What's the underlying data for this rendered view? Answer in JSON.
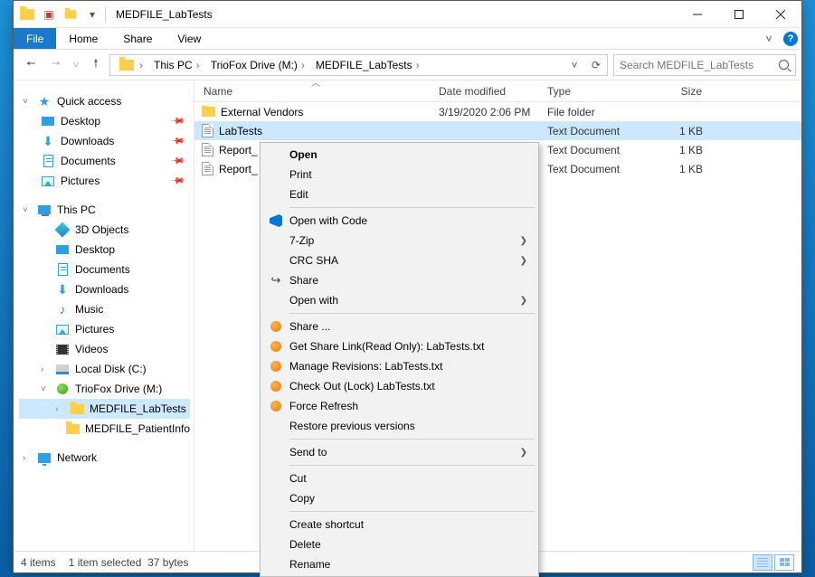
{
  "window": {
    "title": "MEDFILE_LabTests"
  },
  "ribbon": {
    "file": "File",
    "home": "Home",
    "share": "Share",
    "view": "View"
  },
  "breadcrumbs": {
    "thispc": "This PC",
    "drive": "TrioFox Drive (M:)",
    "folder": "MEDFILE_LabTests"
  },
  "search": {
    "placeholder": "Search MEDFILE_LabTests"
  },
  "columns": {
    "name": "Name",
    "date": "Date modified",
    "type": "Type",
    "size": "Size"
  },
  "nav": {
    "quick_access": "Quick access",
    "desktop": "Desktop",
    "downloads": "Downloads",
    "documents": "Documents",
    "pictures": "Pictures",
    "this_pc": "This PC",
    "objects3d": "3D Objects",
    "music": "Music",
    "videos": "Videos",
    "localdisk": "Local Disk (C:)",
    "triofox": "TrioFox Drive (M:)",
    "folder1": "MEDFILE_LabTests",
    "folder2": "MEDFILE_PatientInfo",
    "network": "Network"
  },
  "rows": [
    {
      "name": "External Vendors",
      "date": "3/19/2020 2:06 PM",
      "type": "File folder",
      "size": "",
      "icon": "folder",
      "selected": false
    },
    {
      "name": "LabTests",
      "date": "",
      "type": "Text Document",
      "size": "1 KB",
      "icon": "txt",
      "selected": true,
      "trunc": true
    },
    {
      "name": "Report_",
      "date": "",
      "type": "Text Document",
      "size": "1 KB",
      "icon": "txt",
      "selected": false,
      "trunc": true
    },
    {
      "name": "Report_",
      "date": "",
      "type": "Text Document",
      "size": "1 KB",
      "icon": "txt",
      "selected": false,
      "trunc": true
    }
  ],
  "menu": {
    "open": "Open",
    "print": "Print",
    "edit": "Edit",
    "open_with_code": "Open with Code",
    "seven_zip": "7-Zip",
    "crc_sha": "CRC SHA",
    "share": "Share",
    "open_with": "Open with",
    "share_dots": "Share ...",
    "get_share_link": "Get Share Link(Read Only): LabTests.txt",
    "manage_revisions": "Manage Revisions: LabTests.txt",
    "check_out": "Check Out (Lock) LabTests.txt",
    "force_refresh": "Force Refresh",
    "restore_prev": "Restore previous versions",
    "send_to": "Send to",
    "cut": "Cut",
    "copy": "Copy",
    "create_shortcut": "Create shortcut",
    "delete": "Delete",
    "rename": "Rename"
  },
  "status": {
    "items": "4 items",
    "selected": "1 item selected",
    "bytes": "37 bytes"
  }
}
